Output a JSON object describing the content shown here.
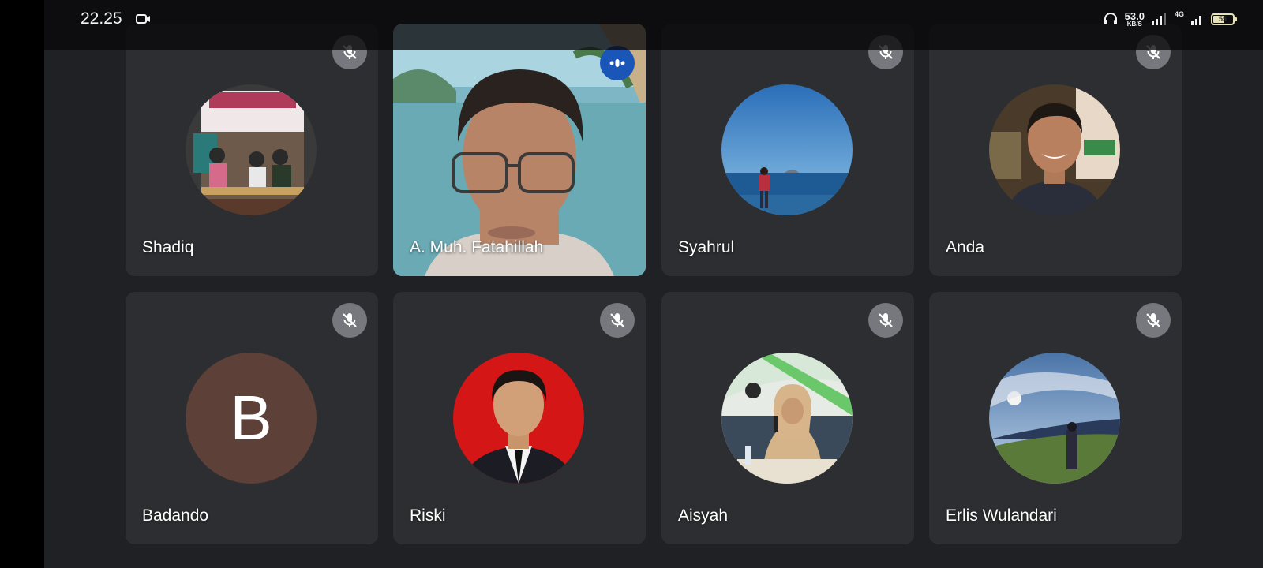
{
  "status_bar": {
    "time": "22.25",
    "net_speed_value": "53.0",
    "net_speed_unit": "KB/S",
    "network_type": "4G",
    "battery": "55"
  },
  "participants": [
    {
      "name": "Shadiq",
      "muted": true,
      "avatar": "photo-group-meeting"
    },
    {
      "name": "A. Muh. Fatahillah",
      "muted": false,
      "speaking": true,
      "video": "webcam-man-glasses-beach-background"
    },
    {
      "name": "Syahrul",
      "muted": true,
      "avatar": "photo-man-on-beach"
    },
    {
      "name": "Anda",
      "muted": true,
      "avatar": "photo-smiling-man"
    },
    {
      "name": "Badando",
      "muted": true,
      "avatar_letter": "B",
      "avatar_color": "#5d4037"
    },
    {
      "name": "Riski",
      "muted": true,
      "avatar": "photo-man-in-suit-red-background"
    },
    {
      "name": "Aisyah",
      "muted": true,
      "avatar": "photo-woman-speaking-microphone"
    },
    {
      "name": "Erlis Wulandari",
      "muted": true,
      "avatar": "photo-person-on-hill-landscape"
    }
  ],
  "colors": {
    "background": "#202124",
    "tile": "#2d2e31",
    "speaking_indicator": "#1a55b8"
  }
}
